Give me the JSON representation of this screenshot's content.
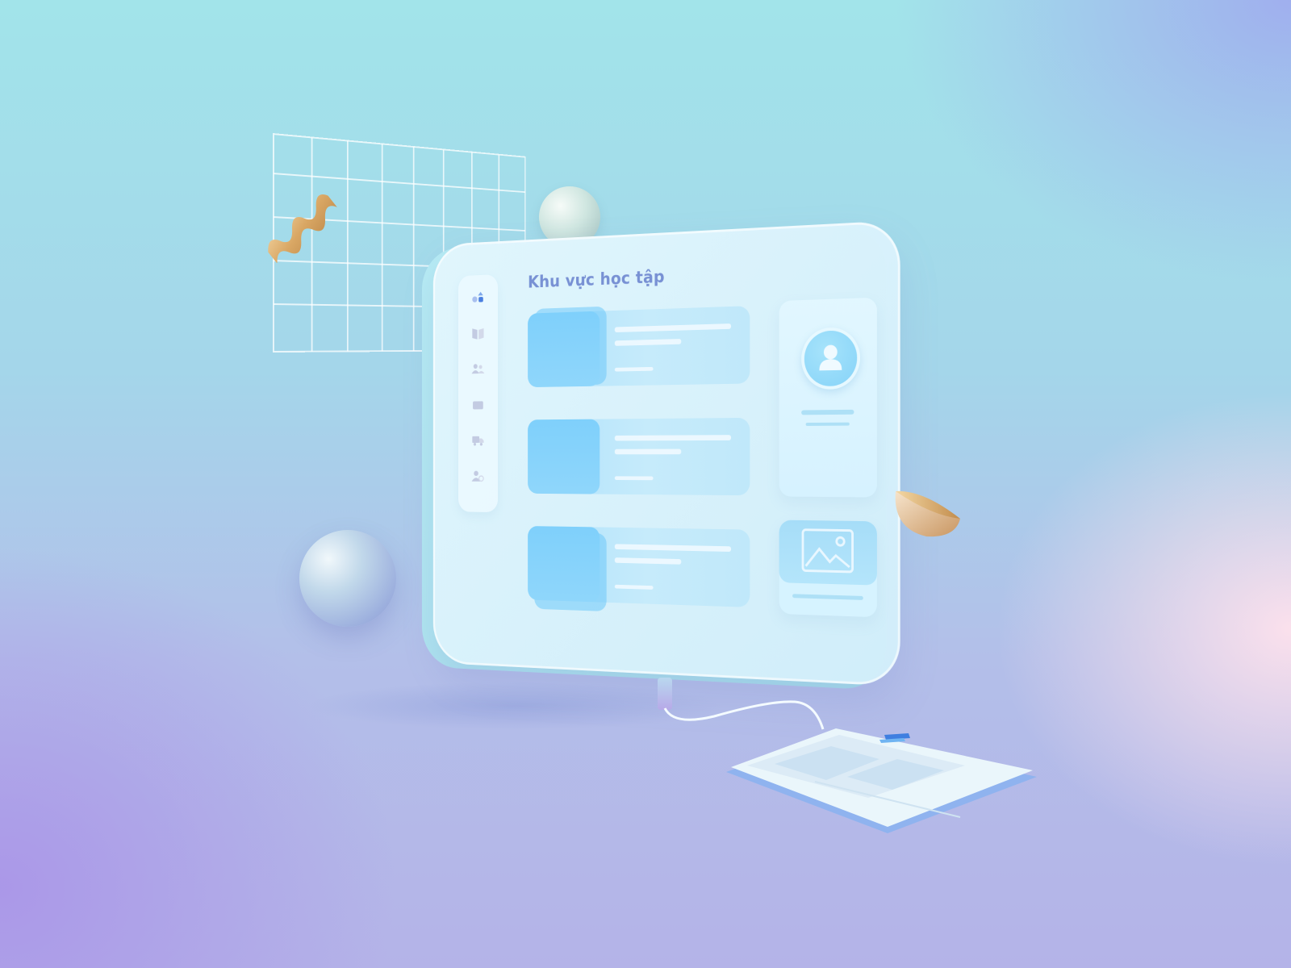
{
  "app": {
    "title": "Khu vực học tập"
  },
  "sidebar": {
    "items": [
      {
        "icon": "shapes-icon",
        "active": true
      },
      {
        "icon": "book-icon",
        "active": false
      },
      {
        "icon": "users-icon",
        "active": false
      },
      {
        "icon": "folder-icon",
        "active": false
      },
      {
        "icon": "truck-icon",
        "active": false
      },
      {
        "icon": "user-clock-icon",
        "active": false
      }
    ]
  },
  "cards": [
    {
      "thumbnail_icon": "placeholder-thumbnail"
    },
    {
      "thumbnail_icon": "placeholder-thumbnail"
    },
    {
      "thumbnail_icon": "placeholder-thumbnail"
    }
  ],
  "profile": {
    "avatar_icon": "user-icon"
  },
  "media": {
    "icon": "image-icon"
  },
  "colors": {
    "title": "#7891d4",
    "active_icon": "#4a7fe0",
    "inactive_icon": "#c3cbe2",
    "thumbnail": "#7fd0fb",
    "card": "#c6ebfb"
  }
}
